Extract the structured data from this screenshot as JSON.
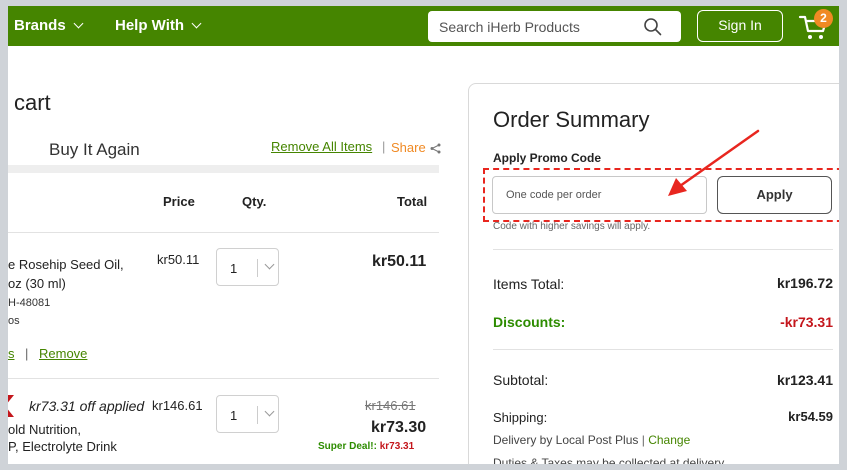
{
  "header": {
    "nav": [
      {
        "label": "Brands"
      },
      {
        "label": "Help With"
      }
    ],
    "search_placeholder": "Search iHerb Products",
    "sign_in": "Sign In",
    "cart_count": "2"
  },
  "cart": {
    "title": "cart",
    "tab_label": "Buy It Again",
    "remove_all": "Remove All Items",
    "share": "Share",
    "table_headers": {
      "price": "Price",
      "qty": "Qty.",
      "total": "Total"
    },
    "items": [
      {
        "name_line1": "e Rosehip Seed Oil,",
        "name_line2": "oz (30 ml)",
        "code": "H-48081",
        "meta": "os",
        "price": "kr50.11",
        "qty": "1",
        "total": "kr50.11",
        "link_left": "s",
        "remove": "Remove"
      },
      {
        "deal_text": "kr73.31 off applied",
        "name_line1": "old Nutrition,",
        "name_line2": "P, Electrolyte Drink",
        "price": "kr146.61",
        "qty": "1",
        "original_total": "kr146.61",
        "total": "kr73.30",
        "super_deal_label": "Super Deal!:",
        "super_deal_value": "kr73.31"
      }
    ]
  },
  "summary": {
    "title": "Order Summary",
    "promo_label": "Apply Promo Code",
    "promo_placeholder": "One code per order",
    "apply": "Apply",
    "promo_hint": "Code with higher savings will apply.",
    "items_total_label": "Items Total:",
    "items_total_value": "kr196.72",
    "discounts_label": "Discounts:",
    "discounts_value": "-kr73.31",
    "subtotal_label": "Subtotal:",
    "subtotal_value": "kr123.41",
    "shipping_label": "Shipping:",
    "shipping_value": "kr54.59",
    "delivery_text": "Delivery by Local Post Plus",
    "change": "Change",
    "duties_text": "Duties & Taxes may be collected at delivery"
  },
  "colors": {
    "brand_green": "#458500",
    "accent_orange": "#f08a24",
    "discount_red": "#c4161c",
    "annotation_red": "#e8261f"
  },
  "icons": [
    "chevron-down-icon",
    "search-icon",
    "cart-icon",
    "share-icon",
    "annotation-arrow"
  ]
}
